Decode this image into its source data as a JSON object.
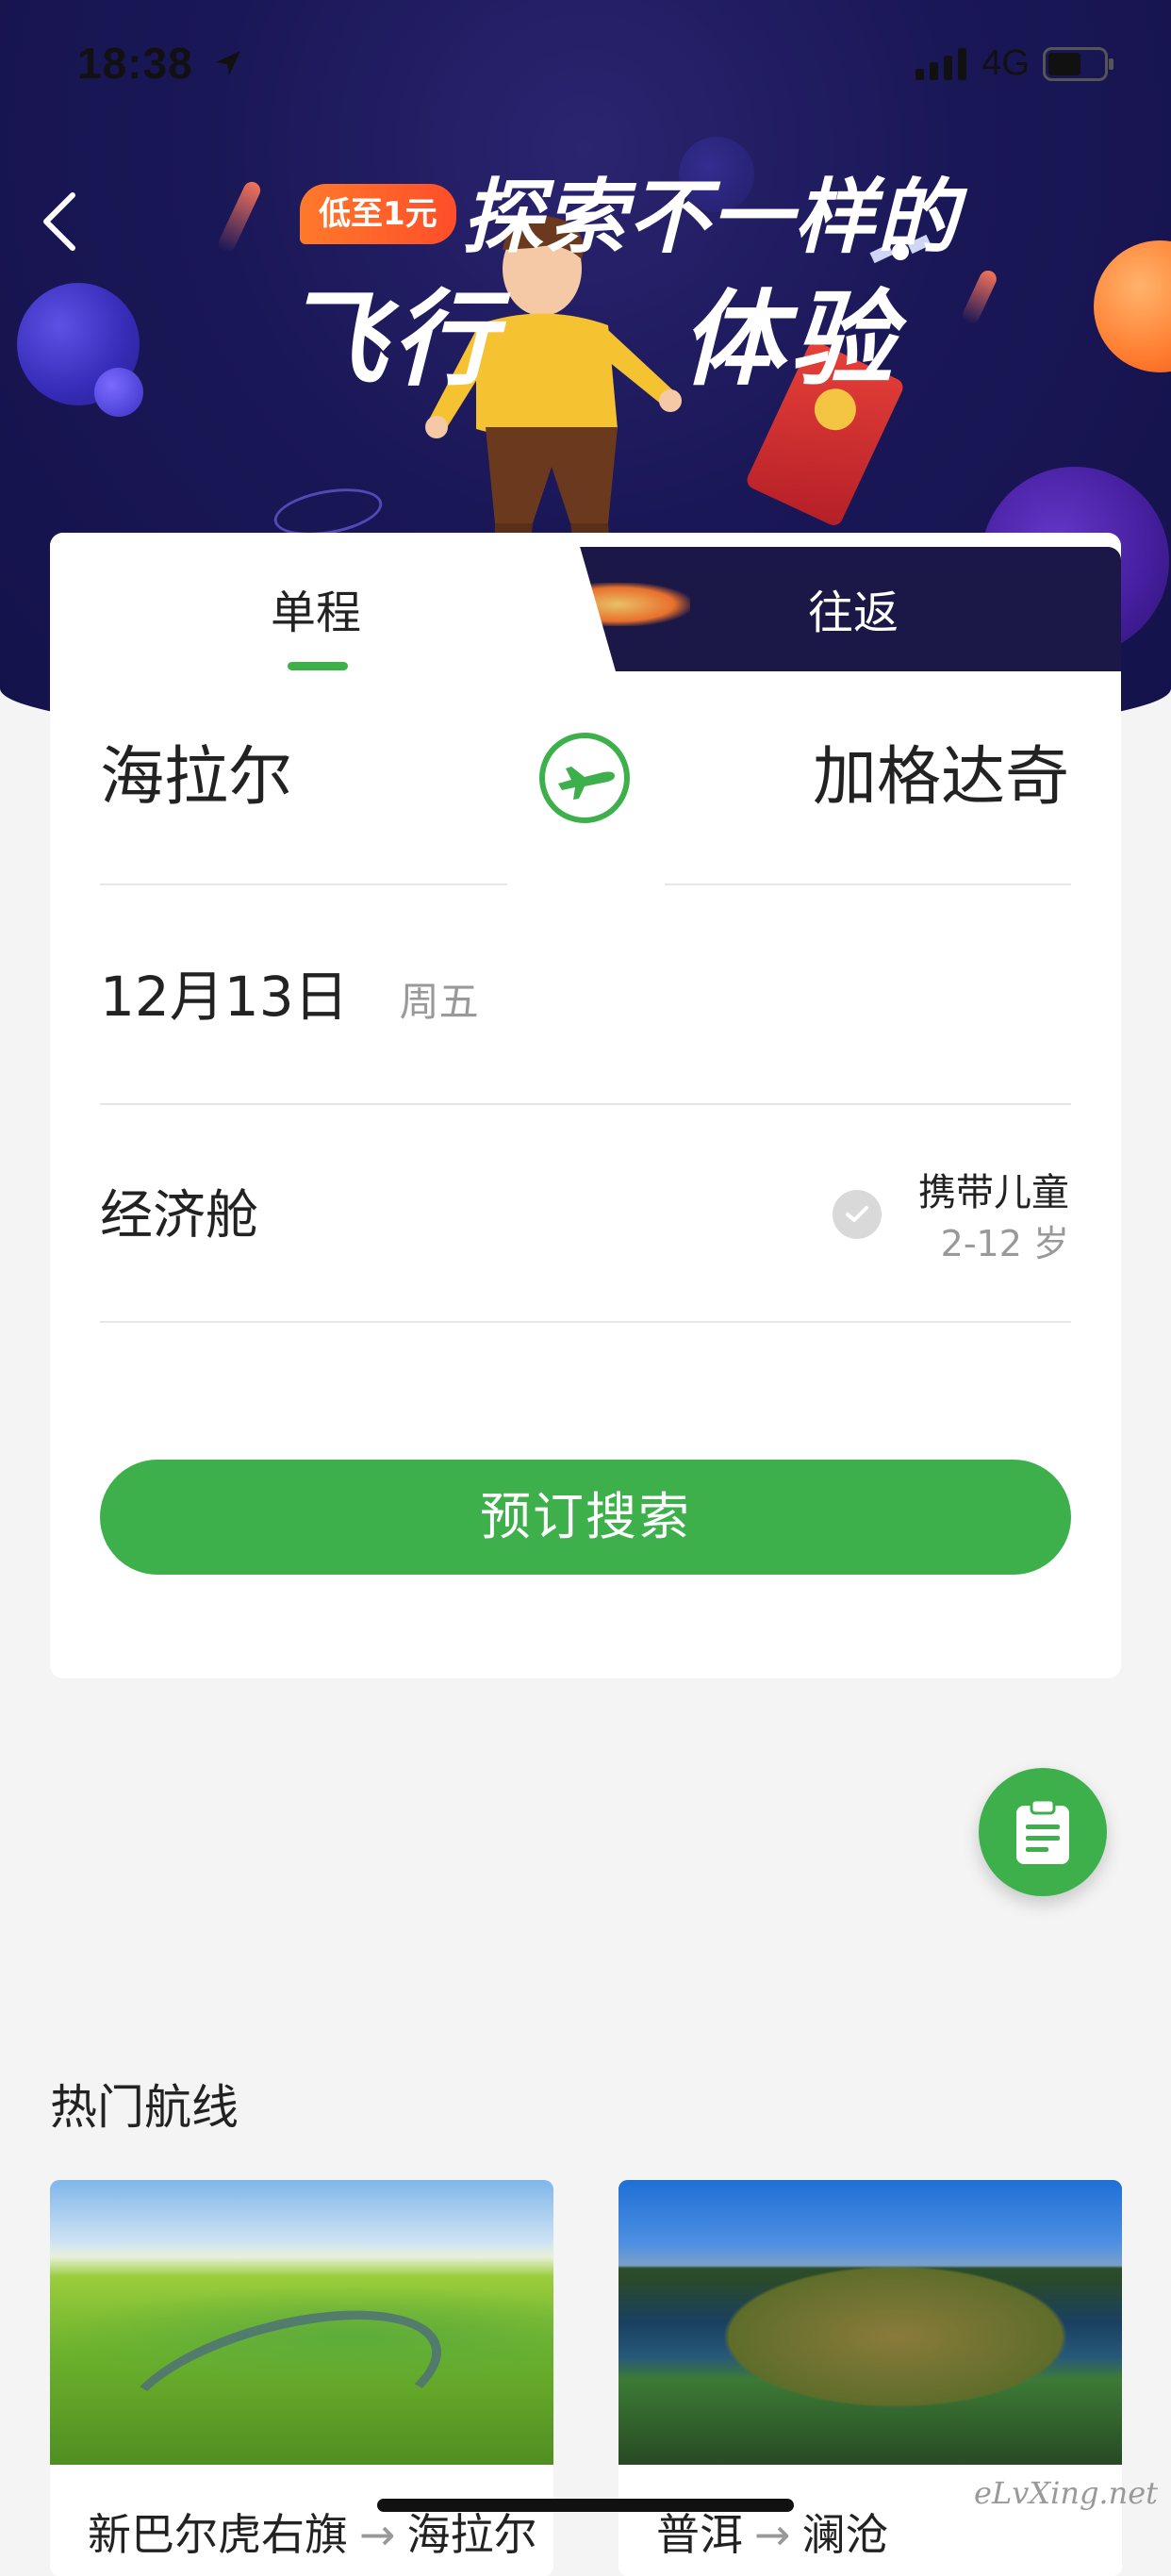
{
  "status_bar": {
    "time": "18:38",
    "network": "4G"
  },
  "banner": {
    "badge": "低至1元",
    "title_line1": "探索不一样的",
    "title_line2_left": "飞行",
    "title_line2_right": "体验"
  },
  "tabs": {
    "one_way": "单程",
    "round_trip": "往返",
    "active": "one_way"
  },
  "search": {
    "from_city": "海拉尔",
    "to_city": "加格达奇",
    "date": "12月13日",
    "weekday": "周五",
    "cabin": "经济舱",
    "with_children_label": "携带儿童",
    "children_age": "2-12 岁",
    "button_label": "预订搜索"
  },
  "hot_routes": {
    "title": "热门航线",
    "items": [
      {
        "from": "新巴尔虎右旗",
        "to": "海拉尔"
      },
      {
        "from": "普洱",
        "to": "澜沧"
      }
    ]
  },
  "route_arrow": "→",
  "watermark": "eLvXing.net",
  "colors": {
    "accent_green": "#3db04c",
    "hero_bg": "#1a1757",
    "page_bg": "#f4f4f4"
  },
  "icons": {
    "back": "chevron-left-icon",
    "swap": "airplane-swap-icon",
    "fab": "clipboard-icon",
    "check": "check-icon"
  }
}
